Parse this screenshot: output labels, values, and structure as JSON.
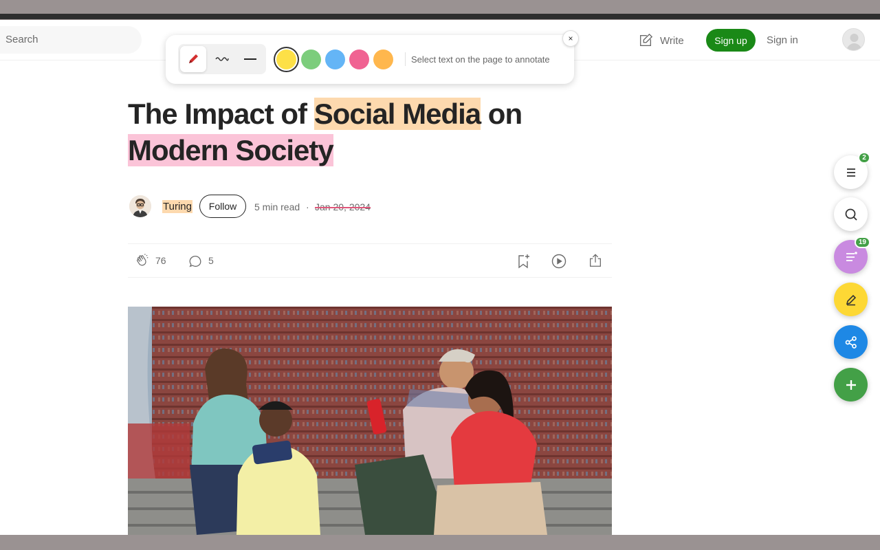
{
  "header": {
    "search_placeholder": "Search",
    "write_label": "Write",
    "signup_label": "Sign up",
    "signin_label": "Sign in"
  },
  "annotate_toolbar": {
    "tools": [
      "pen-icon",
      "wavy-underline-icon",
      "strike-line-icon"
    ],
    "active_tool": "pen-icon",
    "colors": [
      "#fde047",
      "#7ccd7c",
      "#64b5f6",
      "#f06292",
      "#ffb74d"
    ],
    "selected_color": "#fde047",
    "hint": "Select text on the page to annotate",
    "close_label": "×"
  },
  "article": {
    "title_part1": "The Impact of ",
    "title_highlight1": "Social Media",
    "title_part2": " on",
    "title_highlight2": "Modern Society",
    "author": "Turing",
    "follow_label": "Follow",
    "read_time": "5 min read",
    "separator": "·",
    "date": "Jan 20, 2024",
    "claps": "76",
    "comments": "5"
  },
  "floating": {
    "toc_badge": "2",
    "notes_badge": "19"
  },
  "colors": {
    "accent_green": "#1a8917",
    "highlight_orange": "#fdd9ae",
    "highlight_pink": "#fbc4d8"
  }
}
